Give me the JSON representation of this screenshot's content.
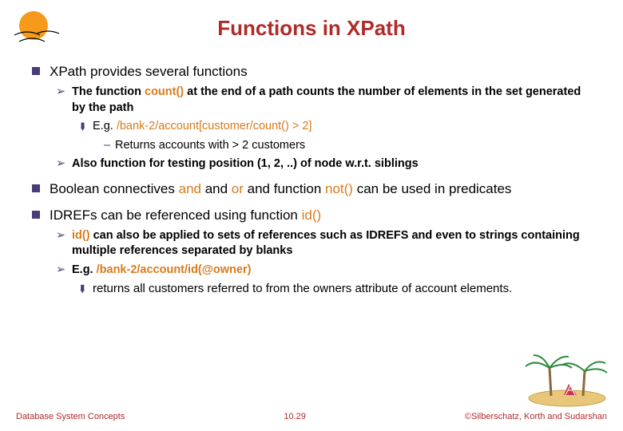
{
  "title": "Functions in XPath",
  "bullets": {
    "b1": "XPath provides several functions",
    "b1_1a": "The function ",
    "b1_1_count": "count()",
    "b1_1b": " at the end of a path counts the number of elements in the set generated by the path",
    "b1_1_1a": "E.g. ",
    "b1_1_1code": "/bank-2/account[customer/count() > 2]",
    "b1_1_1_1": "Returns accounts with > 2 customers",
    "b1_2": "Also function for testing position (1, 2, ..) of node w.r.t. siblings",
    "b2a": "Boolean connectives ",
    "b2_and": "and",
    "b2b": " and ",
    "b2_or": "or",
    "b2c": " and function ",
    "b2_not": "not()",
    "b2d": " can be used in predicates",
    "b3a": "IDREFs can be referenced using function ",
    "b3_id": "id()",
    "b3_1a": "id()",
    "b3_1b": " can also be applied to sets of references such as IDREFS and even to strings containing multiple references separated by blanks",
    "b3_2a": "E.g. ",
    "b3_2code": "/bank-2/account/id(@owner)",
    "b3_2_1": "returns all customers referred to from the owners attribute of account elements."
  },
  "footer": {
    "left": "Database System Concepts",
    "center": "10.29",
    "right": "©Silberschatz, Korth and Sudarshan"
  }
}
